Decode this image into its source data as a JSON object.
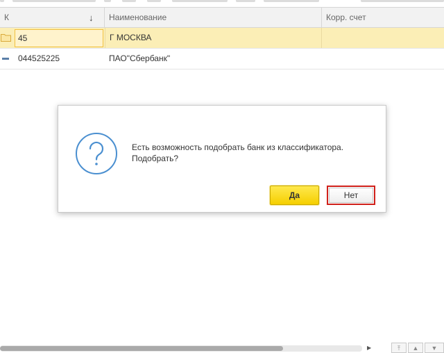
{
  "table": {
    "columns": [
      {
        "label": "К"
      },
      {
        "label": "Наименование"
      },
      {
        "label": "Корр. счет"
      }
    ],
    "sort_indicator": "↓",
    "rows": [
      {
        "code": "45",
        "name": "Г МОСКВА",
        "type": "folder",
        "selected": true
      },
      {
        "code": "044525225",
        "name": "ПАО\"Сбербанк\"",
        "type": "item",
        "selected": false
      }
    ]
  },
  "dialog": {
    "icon": "question-icon",
    "message_line1": "Есть возможность подобрать банк из классификатора.",
    "message_line2": "Подобрать?",
    "yes_label": "Да",
    "no_label": "Нет"
  },
  "colors": {
    "selected_row": "#fbeeb6",
    "yes_button": "#f5cf00",
    "highlight_border": "#d0201a",
    "icon_blue": "#4a8fd0"
  }
}
